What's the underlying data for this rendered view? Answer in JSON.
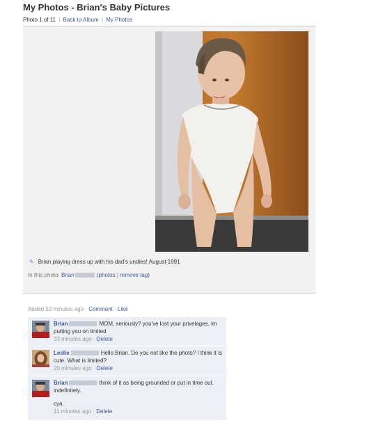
{
  "header": {
    "title": "My Photos - Brian's Baby Pictures",
    "photo_counter": "Photo 1 of 11",
    "back_link": "Back to Album",
    "my_photos_link": "My Photos",
    "separator": "|"
  },
  "photo": {
    "caption": "Brian playing dress up with his dad's undies! August 1991",
    "in_photo_label": "In this photo:",
    "tagged_name": "Brian",
    "photos_link": "(photos",
    "remove_tag_link": "remove tag)",
    "tag_separator": "|"
  },
  "meta": {
    "added": "Added 52 minutes ago",
    "dot": "·",
    "comment_link": "Comment",
    "like_link": "Like"
  },
  "comments": [
    {
      "author": "Brian",
      "text": "MOM, seriously? you've lost your privelages, im putting you on limited",
      "time": "33 minutes ago",
      "delete": "Delete"
    },
    {
      "author": "Leslie",
      "text": "Hello Brian. Do you not like the photo? I think it is cute. What is limited?",
      "time": "20 minutes ago",
      "delete": "Delete"
    },
    {
      "author": "Brian",
      "text": "think of it as being grounded or put in time out. indefinitely.",
      "text2": "cya.",
      "time": "11 minutes ago",
      "delete": "Delete"
    }
  ],
  "icons": {
    "caption_icon": "pencil-icon"
  },
  "colors": {
    "link": "#3b5998",
    "comment_bg": "#eceff5",
    "panel_bg": "#f2f2f2"
  }
}
